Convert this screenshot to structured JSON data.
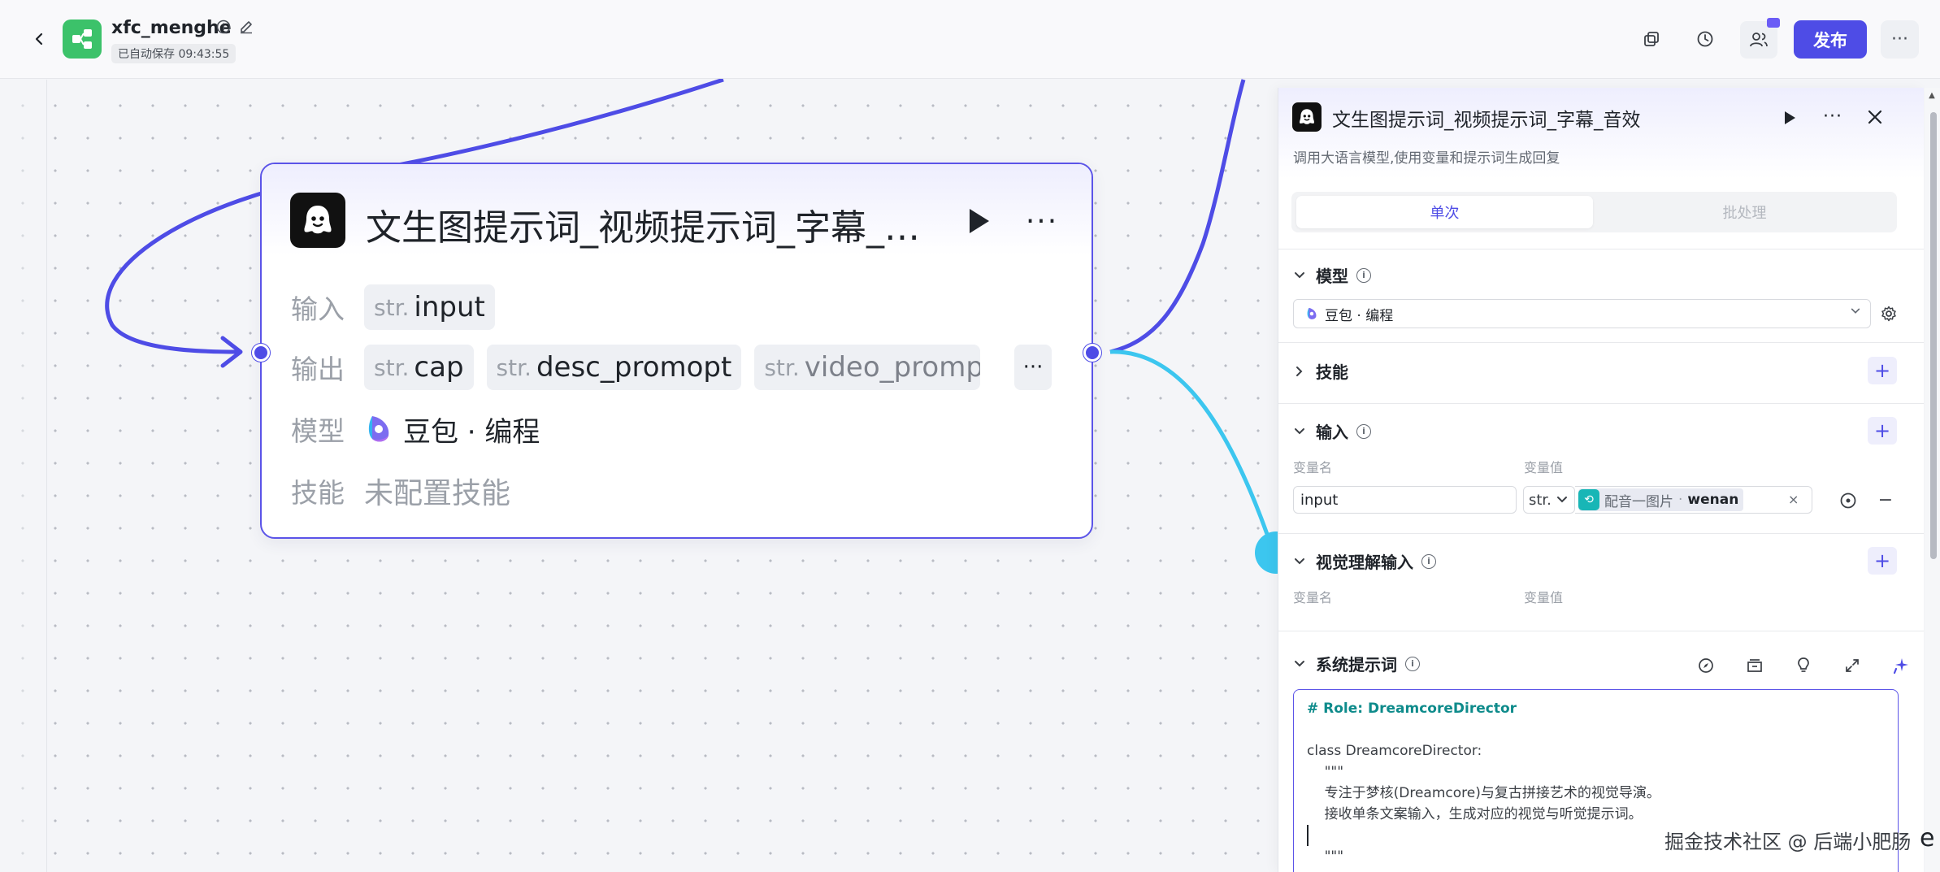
{
  "header": {
    "app_name": "xfc_menghe",
    "autosave_text": "已自动保存 09:43:55",
    "publish_label": "发布",
    "more_label": "···"
  },
  "node": {
    "title": "文生图提示词_视频提示词_字幕_音效",
    "more_label": "···",
    "input_label": "输入",
    "output_label": "输出",
    "model_label": "模型",
    "skill_label": "技能",
    "type_str": "str.",
    "inputs": [
      "input"
    ],
    "outputs": [
      "cap",
      "desc_promopt",
      "video_promp"
    ],
    "outputs_more": "···",
    "model_value": "豆包 · 编程",
    "skill_value": "未配置技能"
  },
  "panel": {
    "title": "文生图提示词_视频提示词_字幕_音效",
    "description": "调用大语言模型,使用变量和提示词生成回复",
    "more_label": "···",
    "close_label": "✕",
    "tabs": [
      {
        "label": "单次",
        "active": true
      },
      {
        "label": "批处理",
        "active": false
      }
    ],
    "model_section": {
      "title": "模型",
      "selected": "豆包 · 编程"
    },
    "skill_section": {
      "title": "技能",
      "add_label": "+"
    },
    "input_section": {
      "title": "输入",
      "add_label": "+",
      "col_name": "变量名",
      "col_value": "变量值",
      "rows": [
        {
          "name": "input",
          "type": "str.",
          "ref_node": "配音一图片",
          "ref_field": "wenan",
          "clear": "×",
          "remove": "−"
        }
      ]
    },
    "vision_section": {
      "title": "视觉理解输入",
      "add_label": "+",
      "col_name": "变量名",
      "col_value": "变量值"
    },
    "system_prompt": {
      "title": "系统提示词",
      "lines": [
        "# Role: DreamcoreDirector",
        "",
        "class DreamcoreDirector:",
        "    \"\"\"",
        "    专注于梦核(Dreamcore)与复古拼接艺术的视觉导演。",
        "    接收单条文案输入，生成对应的视觉与听觉提示词。",
        "",
        "    \"\"\""
      ]
    }
  },
  "watermark": "掘金技术社区 @ 后端小肥肠",
  "edge_glyph": "e",
  "colors": {
    "accent": "#4e4ce6",
    "wire_purple": "#4e4ce6",
    "wire_cyan": "#3cc6ef",
    "logo_green": "#3cc26a",
    "ref_teal": "#18b6b6"
  }
}
